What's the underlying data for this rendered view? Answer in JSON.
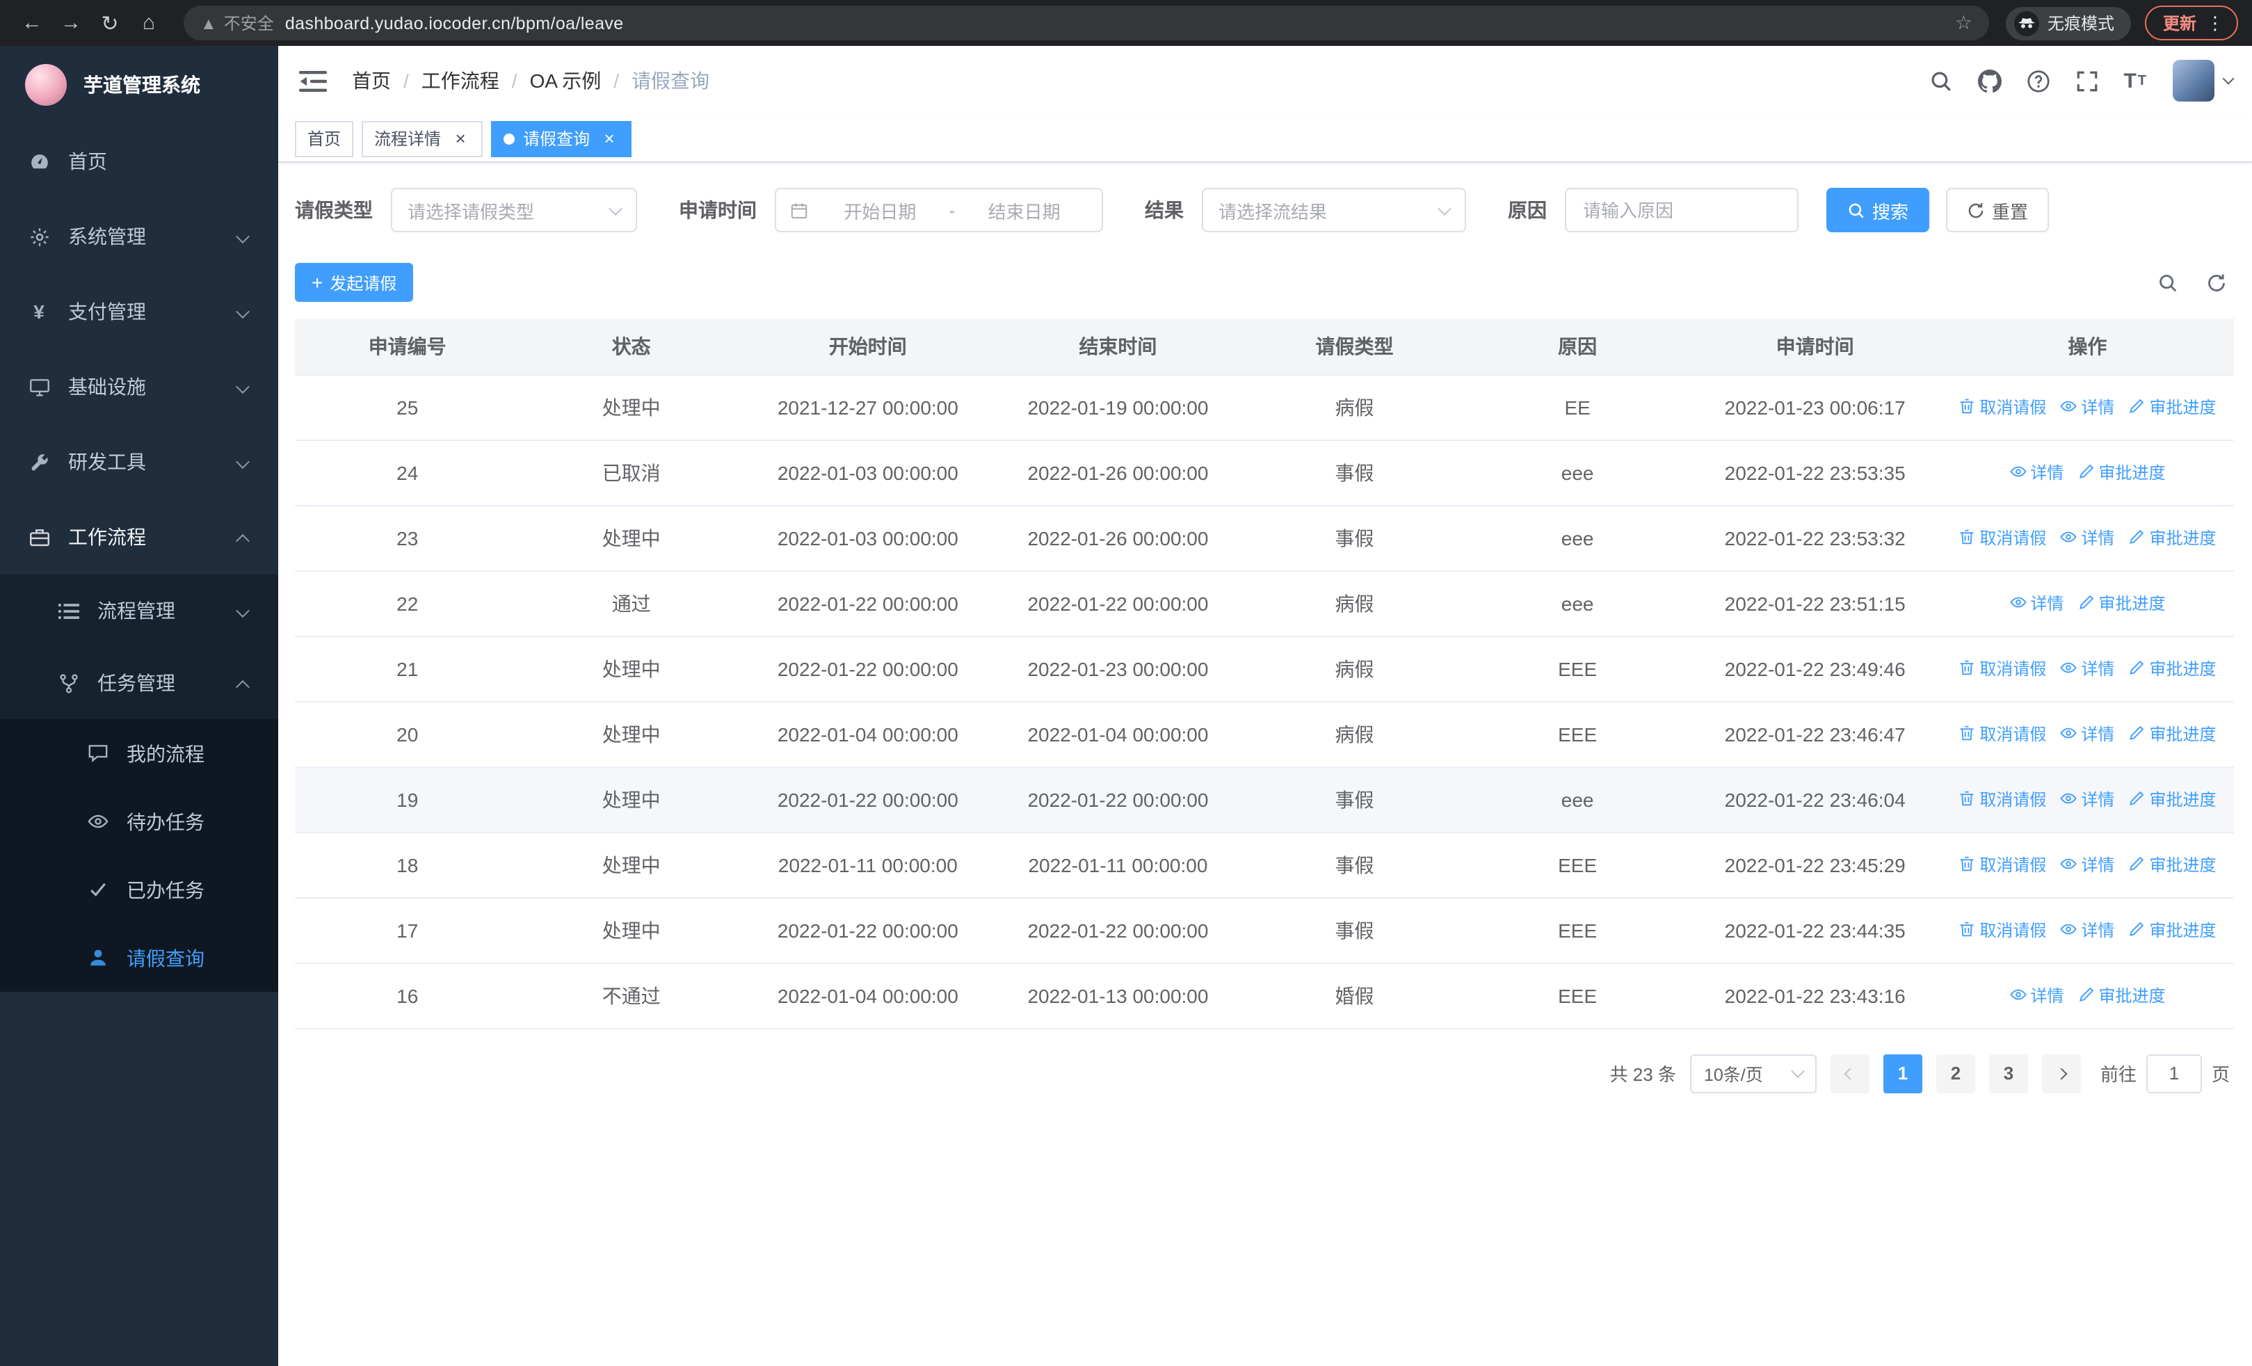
{
  "browser": {
    "security_warning": "不安全",
    "url": "dashboard.yudao.iocoder.cn/bpm/oa/leave",
    "incognito_label": "无痕模式",
    "update_label": "更新"
  },
  "sidebar": {
    "logo_title": "芋道管理系统",
    "menu": [
      {
        "name": "home",
        "label": "首页",
        "icon": "dashboard-icon"
      },
      {
        "name": "system",
        "label": "系统管理",
        "icon": "gear-icon",
        "chevron": "down"
      },
      {
        "name": "payment",
        "label": "支付管理",
        "icon": "yen-icon",
        "chevron": "down"
      },
      {
        "name": "infrastructure",
        "label": "基础设施",
        "icon": "monitor-icon",
        "chevron": "down"
      },
      {
        "name": "dev-tools",
        "label": "研发工具",
        "icon": "wrench-icon",
        "chevron": "down"
      },
      {
        "name": "workflow",
        "label": "工作流程",
        "icon": "briefcase-icon",
        "chevron": "up",
        "active": true,
        "children": [
          {
            "name": "process-management",
            "label": "流程管理",
            "icon": "list-icon",
            "chevron": "down"
          },
          {
            "name": "task-management",
            "label": "任务管理",
            "icon": "branch-icon",
            "chevron": "up",
            "children": [
              {
                "name": "my-process",
                "label": "我的流程",
                "icon": "chat-icon"
              },
              {
                "name": "todo-tasks",
                "label": "待办任务",
                "icon": "eye-icon"
              },
              {
                "name": "done-tasks",
                "label": "已办任务",
                "icon": "check-icon"
              },
              {
                "name": "leave-query",
                "label": "请假查询",
                "icon": "user-icon",
                "active": true
              }
            ]
          }
        ]
      }
    ]
  },
  "header": {
    "breadcrumb": [
      "首页",
      "工作流程",
      "OA 示例",
      "请假查询"
    ]
  },
  "tabs": [
    {
      "name": "home",
      "label": "首页",
      "closable": false,
      "active": false
    },
    {
      "name": "process-detail",
      "label": "流程详情",
      "closable": true,
      "active": false
    },
    {
      "name": "leave-query",
      "label": "请假查询",
      "closable": true,
      "active": true
    }
  ],
  "filters": {
    "leave_type_label": "请假类型",
    "leave_type_placeholder": "请选择请假类型",
    "apply_time_label": "申请时间",
    "start_date_placeholder": "开始日期",
    "date_separator": "-",
    "end_date_placeholder": "结束日期",
    "result_label": "结果",
    "result_placeholder": "请选择流结果",
    "reason_label": "原因",
    "reason_placeholder": "请输入原因",
    "search_label": "搜索",
    "reset_label": "重置"
  },
  "toolbar": {
    "create_label": "发起请假"
  },
  "table": {
    "columns": [
      "申请编号",
      "状态",
      "开始时间",
      "结束时间",
      "请假类型",
      "原因",
      "申请时间",
      "操作"
    ],
    "action_defs": {
      "cancel": {
        "label": "取消请假",
        "icon": "delete-icon"
      },
      "detail": {
        "label": "详情",
        "icon": "eye-icon"
      },
      "progress": {
        "label": "审批进度",
        "icon": "edit-icon"
      }
    },
    "rows": [
      {
        "id": "25",
        "status": "处理中",
        "start": "2021-12-27 00:00:00",
        "end": "2022-01-19 00:00:00",
        "type": "病假",
        "reason": "EE",
        "applied": "2022-01-23 00:06:17",
        "actions": [
          "cancel",
          "detail",
          "progress"
        ],
        "highlight": false
      },
      {
        "id": "24",
        "status": "已取消",
        "start": "2022-01-03 00:00:00",
        "end": "2022-01-26 00:00:00",
        "type": "事假",
        "reason": "eee",
        "applied": "2022-01-22 23:53:35",
        "actions": [
          "detail",
          "progress"
        ],
        "highlight": false
      },
      {
        "id": "23",
        "status": "处理中",
        "start": "2022-01-03 00:00:00",
        "end": "2022-01-26 00:00:00",
        "type": "事假",
        "reason": "eee",
        "applied": "2022-01-22 23:53:32",
        "actions": [
          "cancel",
          "detail",
          "progress"
        ],
        "highlight": false
      },
      {
        "id": "22",
        "status": "通过",
        "start": "2022-01-22 00:00:00",
        "end": "2022-01-22 00:00:00",
        "type": "病假",
        "reason": "eee",
        "applied": "2022-01-22 23:51:15",
        "actions": [
          "detail",
          "progress"
        ],
        "highlight": false
      },
      {
        "id": "21",
        "status": "处理中",
        "start": "2022-01-22 00:00:00",
        "end": "2022-01-23 00:00:00",
        "type": "病假",
        "reason": "EEE",
        "applied": "2022-01-22 23:49:46",
        "actions": [
          "cancel",
          "detail",
          "progress"
        ],
        "highlight": false
      },
      {
        "id": "20",
        "status": "处理中",
        "start": "2022-01-04 00:00:00",
        "end": "2022-01-04 00:00:00",
        "type": "病假",
        "reason": "EEE",
        "applied": "2022-01-22 23:46:47",
        "actions": [
          "cancel",
          "detail",
          "progress"
        ],
        "highlight": false
      },
      {
        "id": "19",
        "status": "处理中",
        "start": "2022-01-22 00:00:00",
        "end": "2022-01-22 00:00:00",
        "type": "事假",
        "reason": "eee",
        "applied": "2022-01-22 23:46:04",
        "actions": [
          "cancel",
          "detail",
          "progress"
        ],
        "highlight": true
      },
      {
        "id": "18",
        "status": "处理中",
        "start": "2022-01-11 00:00:00",
        "end": "2022-01-11 00:00:00",
        "type": "事假",
        "reason": "EEE",
        "applied": "2022-01-22 23:45:29",
        "actions": [
          "cancel",
          "detail",
          "progress"
        ],
        "highlight": false
      },
      {
        "id": "17",
        "status": "处理中",
        "start": "2022-01-22 00:00:00",
        "end": "2022-01-22 00:00:00",
        "type": "事假",
        "reason": "EEE",
        "applied": "2022-01-22 23:44:35",
        "actions": [
          "cancel",
          "detail",
          "progress"
        ],
        "highlight": false
      },
      {
        "id": "16",
        "status": "不通过",
        "start": "2022-01-04 00:00:00",
        "end": "2022-01-13 00:00:00",
        "type": "婚假",
        "reason": "EEE",
        "applied": "2022-01-22 23:43:16",
        "actions": [
          "detail",
          "progress"
        ],
        "highlight": false
      }
    ]
  },
  "pagination": {
    "total": "共 23 条",
    "page_size": "10条/页",
    "pages": [
      "1",
      "2",
      "3"
    ],
    "active_page": "1",
    "goto_label": "前往",
    "goto_value": "1",
    "page_label": "页"
  },
  "colors": {
    "primary": "#409eff",
    "sidebar_bg": "#1f2d3d",
    "chrome_bg": "#202124",
    "update_red": "#e8705a"
  }
}
